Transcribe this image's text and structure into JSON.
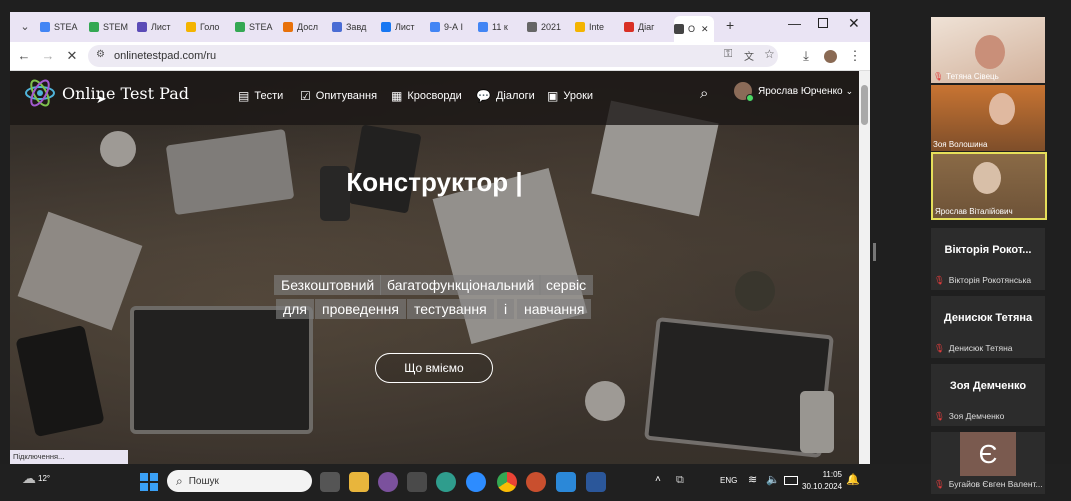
{
  "browser": {
    "tabs": [
      {
        "label": "STEA",
        "color": "#4285f4"
      },
      {
        "label": "STEM",
        "color": "#34a853"
      },
      {
        "label": "Лист",
        "color": "#5b4bb7"
      },
      {
        "label": "Голо",
        "color": "#f4b400"
      },
      {
        "label": "STEA",
        "color": "#34a853"
      },
      {
        "label": "Досл",
        "color": "#e8710a"
      },
      {
        "label": "Завд",
        "color": "#4a6cd4"
      },
      {
        "label": "Лист",
        "color": "#1877f2"
      },
      {
        "label": "9-А І",
        "color": "#4285f4"
      },
      {
        "label": "11 к",
        "color": "#4285f4"
      },
      {
        "label": "2021",
        "color": "#666666"
      },
      {
        "label": "Inte",
        "color": "#f4b400"
      },
      {
        "label": "Діаг",
        "color": "#d93025"
      },
      {
        "label": "О",
        "color": "#444444"
      }
    ],
    "new_tab_icon": "plus-icon",
    "window_controls": [
      "minimize-icon",
      "restore-icon",
      "close-icon"
    ],
    "url": "onlinetestpad.com/ru",
    "status": "Підключення..."
  },
  "site": {
    "logo_text": "Online Test Pad",
    "nav": [
      {
        "label": "Тести",
        "icon": "clipboard-icon"
      },
      {
        "label": "Опитування",
        "icon": "survey-icon"
      },
      {
        "label": "Кросворди",
        "icon": "crossword-icon"
      },
      {
        "label": "Діалоги",
        "icon": "chat-icon"
      },
      {
        "label": "Уроки",
        "icon": "lesson-icon"
      }
    ],
    "user_name": "Ярослав Юрченко",
    "hero": {
      "title": "Конструктор |",
      "subtitle_line1": [
        "Безкоштовний",
        "багатофункціональний",
        "сервіс"
      ],
      "subtitle_line2": [
        "для",
        "проведення",
        "тестування",
        "і",
        "навчання"
      ],
      "cta": "Що вміємо"
    }
  },
  "taskbar": {
    "weather": "12°",
    "search_placeholder": "Пошук",
    "lang": "ENG",
    "time": "11:05",
    "date": "30.10.2024"
  },
  "meeting": {
    "video_tiles": [
      {
        "name": "Тетяна Сівець",
        "bg": "#d9b9a0"
      },
      {
        "name": "Зоя Волошина",
        "bg": "#b8662b"
      },
      {
        "name": "Ярослав Віталійович",
        "bg": "#7a5a3c"
      }
    ],
    "participants": [
      {
        "big": "Вікторія Рокот...",
        "small": "Вікторія Рокотянська"
      },
      {
        "big": "Денисюк Тетяна",
        "small": "Денисюк Тетяна"
      },
      {
        "big": "Зоя Демченко",
        "small": "Зоя Демченко"
      },
      {
        "avatar": "Є",
        "small": "Бугайов Євген Валент..."
      }
    ]
  }
}
